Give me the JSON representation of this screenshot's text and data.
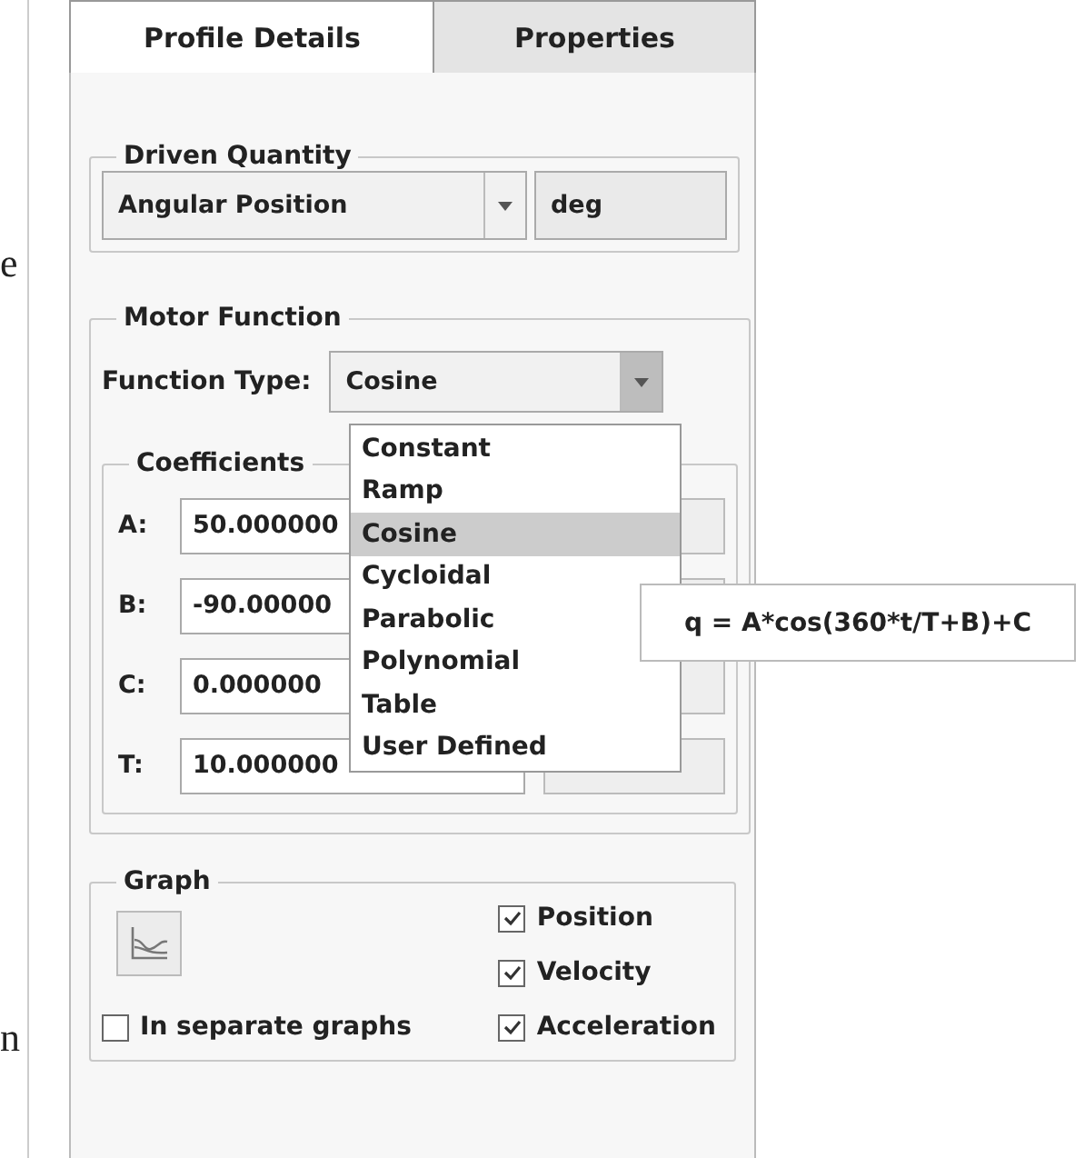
{
  "margin_text": [
    "e",
    "n"
  ],
  "tabs": [
    {
      "label": "Profile Details",
      "selected": true
    },
    {
      "label": "Properties",
      "selected": false
    }
  ],
  "driven_quantity": {
    "title": "Driven Quantity",
    "value": "Angular Position",
    "unit": "deg"
  },
  "motor_function": {
    "title": "Motor Function",
    "function_type_label": "Function Type:",
    "function_type": "Cosine",
    "options": [
      {
        "label": "Constant",
        "selected": false
      },
      {
        "label": "Ramp",
        "selected": false
      },
      {
        "label": "Cosine",
        "selected": true
      },
      {
        "label": "Cycloidal",
        "selected": false
      },
      {
        "label": "Parabolic",
        "selected": false
      },
      {
        "label": "Polynomial",
        "selected": false
      },
      {
        "label": "Table",
        "selected": false
      },
      {
        "label": "User Defined",
        "selected": false
      }
    ],
    "tooltip": "q = A*cos(360*t/T+B)+C",
    "coefficients": {
      "title": "Coefficients",
      "rows": [
        {
          "label": "A:",
          "value": "50.000000"
        },
        {
          "label": "B:",
          "value": "-90.00000"
        },
        {
          "label": "C:",
          "value": "0.000000"
        },
        {
          "label": "T:",
          "value": "10.000000"
        }
      ]
    }
  },
  "graph": {
    "title": "Graph",
    "separate": {
      "label": "In separate graphs",
      "checked": false
    },
    "curves": [
      {
        "label": "Position",
        "checked": true
      },
      {
        "label": "Velocity",
        "checked": true
      },
      {
        "label": "Acceleration",
        "checked": true
      }
    ]
  }
}
